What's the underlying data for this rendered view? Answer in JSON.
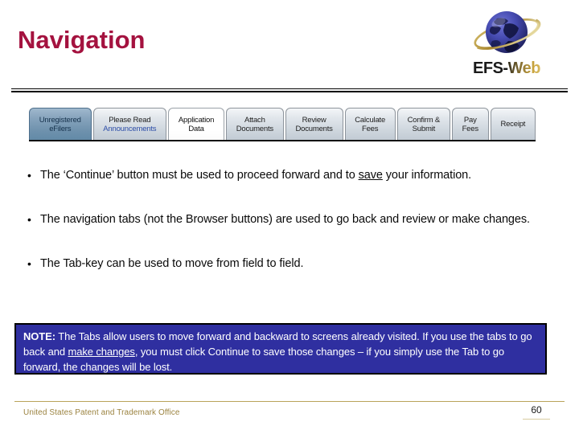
{
  "slide": {
    "title": "Navigation",
    "title_color": "#A4123F"
  },
  "logo": {
    "icon": "globe-icon",
    "text_primary": "EFS-",
    "text_secondary": "Web",
    "globe_color": "#3b3f9e",
    "ring_color": "#b99a3c"
  },
  "tabs": [
    {
      "line1": "Unregistered",
      "line2": "eFilers",
      "state": "visited-selected"
    },
    {
      "line1": "Please Read",
      "line2": "Announcements",
      "state": "visited"
    },
    {
      "line1": "Application",
      "line2": "Data",
      "state": "active"
    },
    {
      "line1": "Attach",
      "line2": "Documents",
      "state": "default"
    },
    {
      "line1": "Review",
      "line2": "Documents",
      "state": "default"
    },
    {
      "line1": "Calculate",
      "line2": "Fees",
      "state": "default"
    },
    {
      "line1": "Confirm &",
      "line2": "Submit",
      "state": "default"
    },
    {
      "line1": "Pay",
      "line2": "Fees",
      "state": "default"
    },
    {
      "line1": "Receipt",
      "line2": "",
      "state": "default"
    }
  ],
  "bullets": [
    {
      "marker": "•",
      "pre": "The ‘Continue’ button must be used to proceed forward and to ",
      "underlined": "save",
      "post": " your information."
    },
    {
      "marker": "•",
      "pre": "The navigation tabs (not the Browser buttons) are used to go back and review or make changes.",
      "underlined": "",
      "post": ""
    },
    {
      "marker": "•",
      "pre": "The Tab-key can be used to move from field to field.",
      "underlined": "",
      "post": ""
    }
  ],
  "note": {
    "label": "NOTE:",
    "part1": " The Tabs allow users to move forward and backward to screens already visited. If you use the tabs to go back and ",
    "underlined": "make changes",
    "part2": ", you must click Continue to save those changes – if you simply use the Tab to go forward, the changes will be lost.",
    "bg_color": "#2F2FA0",
    "text_color": "#FFFFFF"
  },
  "footer": {
    "organization": "United States Patent and Trademark Office",
    "page_number": "60",
    "rule_color": "#B9A35A"
  }
}
